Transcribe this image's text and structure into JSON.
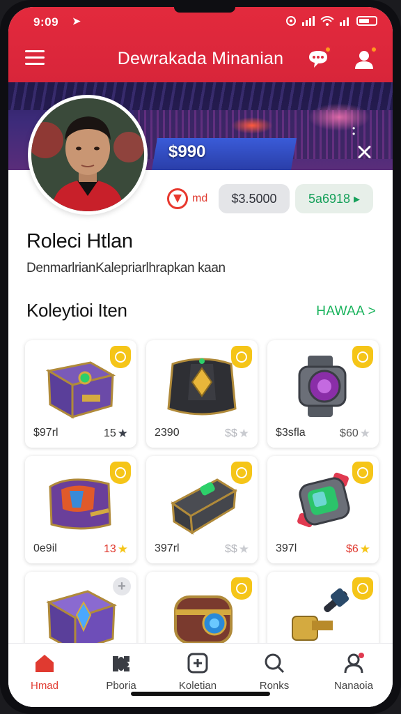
{
  "status_bar": {
    "time": "9:09",
    "nav_arrow": "➤"
  },
  "header": {
    "title": "Dewrakada Minanian"
  },
  "banner": {
    "value": "$990"
  },
  "stats": {
    "badge_label": "md",
    "grey_pill": "$3.5000",
    "green_pill": "5a6918 ▸"
  },
  "profile": {
    "name": "Roleci Htlan",
    "description": "DenmarlrianKalepriarlhrapkan kaan"
  },
  "collection": {
    "title": "Koleytioi Iten",
    "see_all": "HAWAA >",
    "items": [
      {
        "code": "$97rl",
        "price": "15",
        "star_color": "#3a3f4a",
        "art": "purple-chest"
      },
      {
        "code": "2390",
        "price": "$$",
        "star_color": "#c9cbd0",
        "art": "black-armor"
      },
      {
        "code": "$3sfla",
        "price": "$60",
        "star_color": "#c9cbd0",
        "art": "gauntlet"
      },
      {
        "code": "0e9il",
        "price": "13",
        "star_color": "#f5c518",
        "art": "wrapped-chest"
      },
      {
        "code": "397rl",
        "price": "$$",
        "star_color": "#c9cbd0",
        "art": "dark-chest"
      },
      {
        "code": "397l",
        "price": "$6",
        "star_color": "#f5c518",
        "art": "wrist-device"
      },
      {
        "code": "",
        "price": "",
        "star_color": "",
        "art": "card-chest"
      },
      {
        "code": "",
        "price": "",
        "star_color": "",
        "art": "barrel"
      },
      {
        "code": "",
        "price": "",
        "star_color": "",
        "art": "hammer"
      }
    ]
  },
  "bottom_nav": [
    {
      "label": "Hmad",
      "icon": "home-icon",
      "active": true
    },
    {
      "label": "Pboria",
      "icon": "puzzle-icon",
      "active": false
    },
    {
      "label": "Koletian",
      "icon": "collection-icon",
      "active": false
    },
    {
      "label": "Ronks",
      "icon": "search-icon",
      "active": false
    },
    {
      "label": "Nanaoia",
      "icon": "profile-icon",
      "active": false
    }
  ],
  "colors": {
    "brand_red": "#e02a3c",
    "accent_green": "#19b35c",
    "badge_yellow": "#f5c518"
  }
}
